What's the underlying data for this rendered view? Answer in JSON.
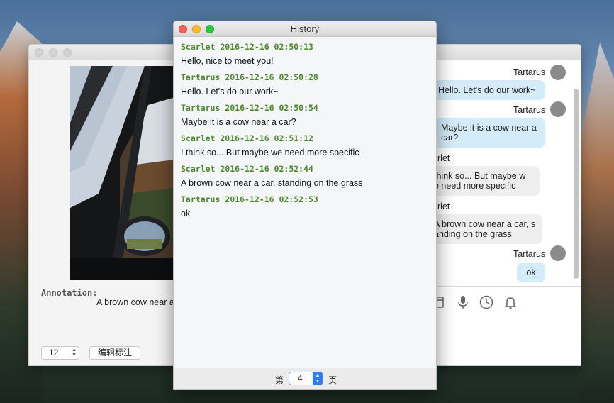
{
  "history_window": {
    "title": "History",
    "messages": [
      {
        "meta": "Scarlet 2016-12-16 02:50:13",
        "text": "Hello, nice to meet you!"
      },
      {
        "meta": "Tartarus 2016-12-16 02:50:28",
        "text": "Hello. Let's do our work~"
      },
      {
        "meta": "Tartarus 2016-12-16 02:50:54",
        "text": "Maybe it is a cow near a car?"
      },
      {
        "meta": "Scarlet 2016-12-16 02:51:12",
        "text": "I think so... But maybe we need more specific"
      },
      {
        "meta": "Scarlet 2016-12-16 02:52:44",
        "text": "A brown cow near a car, standing on the grass"
      },
      {
        "meta": "Tartarus 2016-12-16 02:52:53",
        "text": "ok"
      }
    ],
    "footer": {
      "prefix": "第",
      "page": "4",
      "suffix": "页"
    }
  },
  "annotation_window": {
    "annotation_label": "Annotation:",
    "annotation_text": "A brown cow near a",
    "font_size_value": "12",
    "edit_button_label": "编辑标注"
  },
  "chat_window": {
    "items": [
      {
        "sender": "Tartarus",
        "text": "Hello. Let's do our work~",
        "side": "right"
      },
      {
        "sender": "Tartarus",
        "text_line1": "Maybe it is a cow near a",
        "text_line2": "car?",
        "side": "right"
      },
      {
        "sender": "rlet",
        "text_line1": "think so... But maybe w",
        "text_line2": "e need more specific",
        "side": "left"
      },
      {
        "sender": "rlet",
        "text_line1": "A brown cow near a car, s",
        "text_line2": "anding on the grass",
        "side": "left"
      },
      {
        "sender": "Tartarus",
        "text": "ok",
        "side": "right"
      }
    ],
    "toolbar_icons": [
      "calendar-icon",
      "microphone-icon",
      "clock-icon",
      "bell-icon"
    ]
  },
  "colors": {
    "meta_green": "#4a8a2a",
    "bubble_blue": "#d4ecfa",
    "bubble_gray": "#efefef",
    "accent_blue": "#2e7cf6"
  }
}
